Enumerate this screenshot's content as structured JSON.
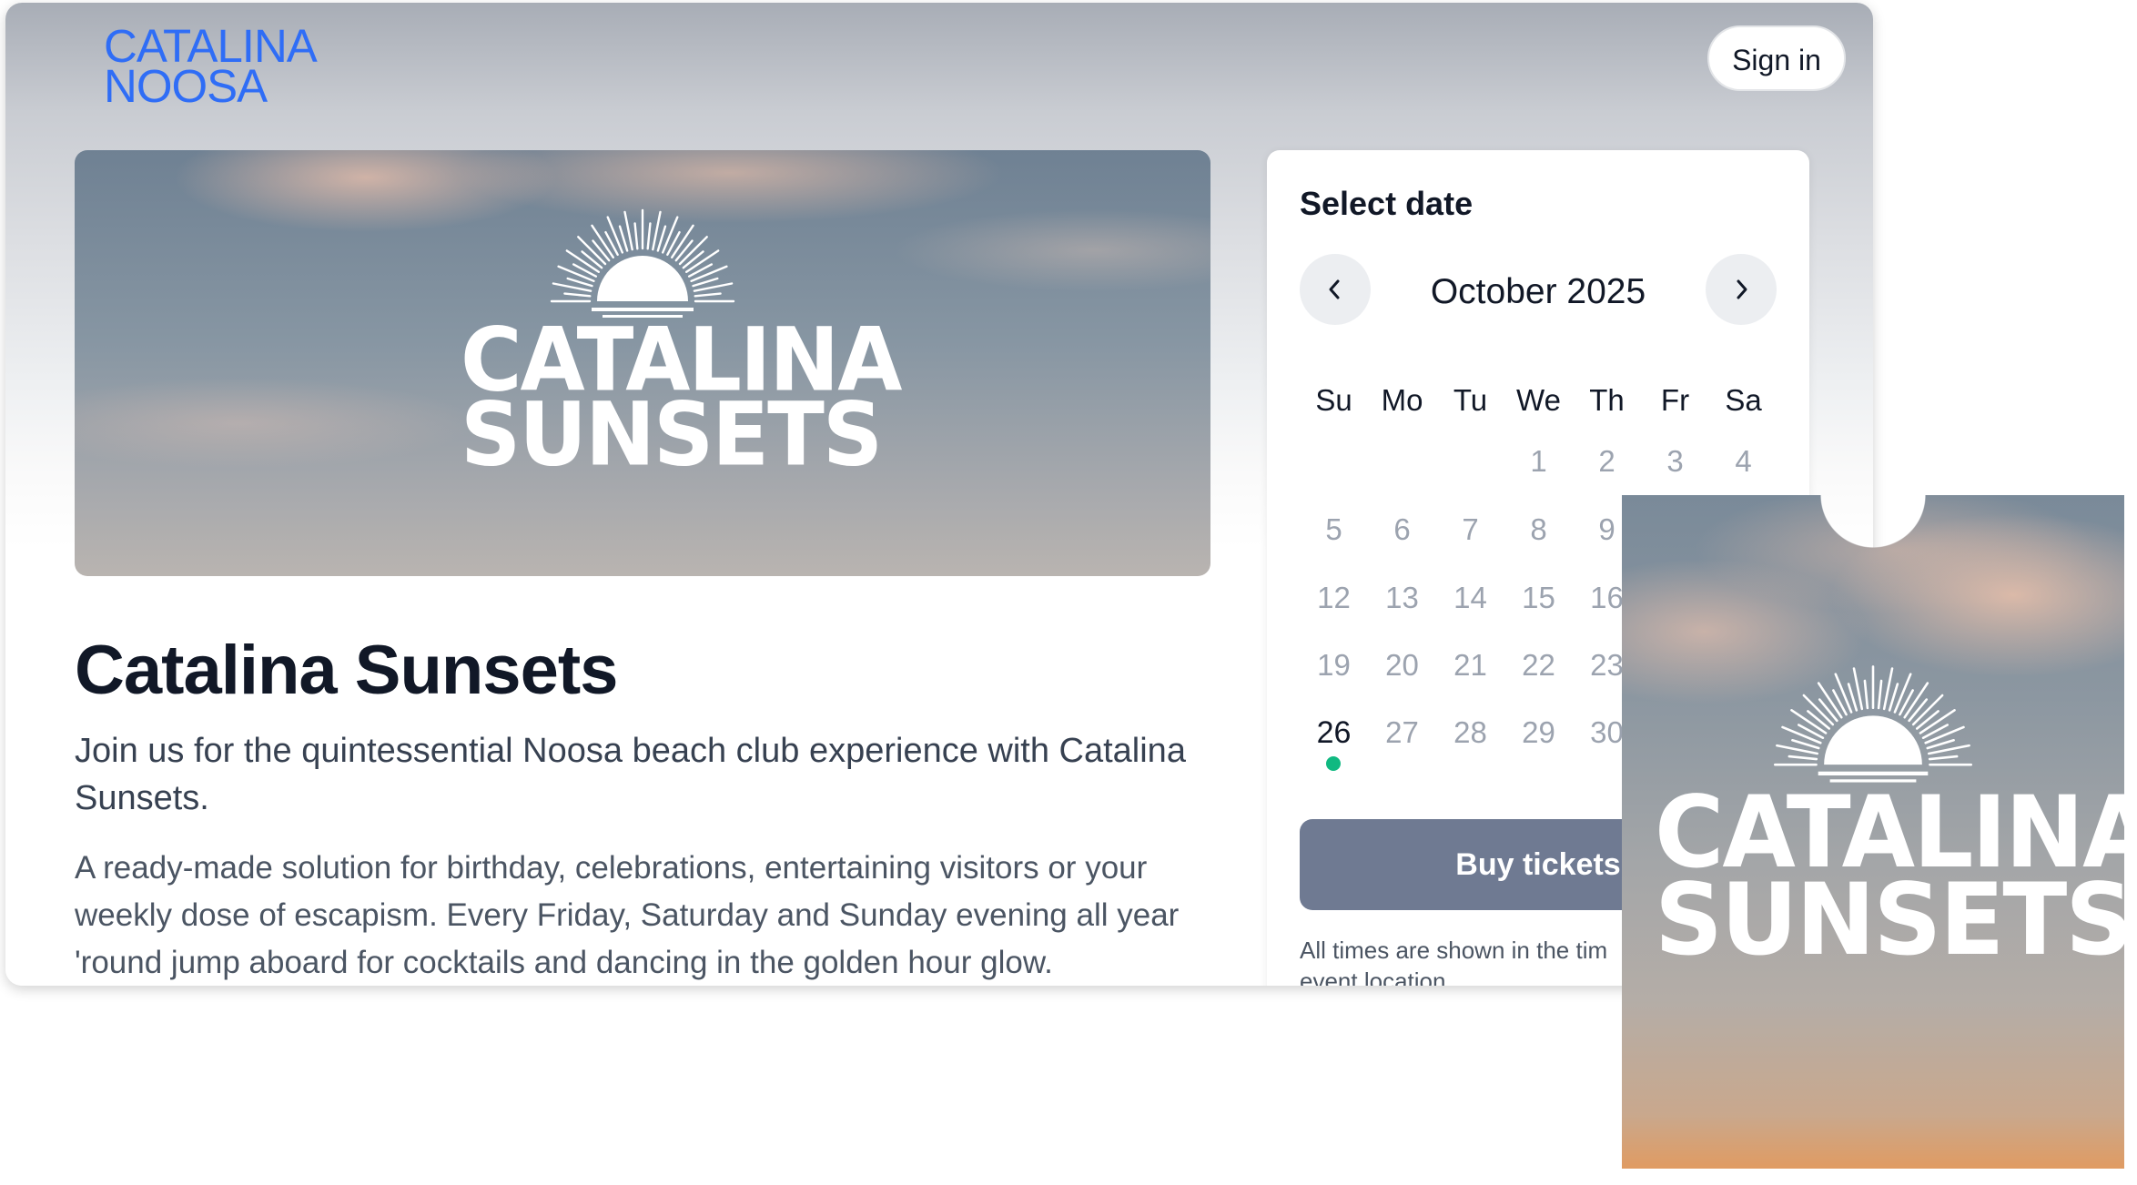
{
  "header": {
    "logo_line1": "CATALINA",
    "logo_line2": "NOOSA",
    "signin_label": "Sign in"
  },
  "hero": {
    "logo_word1": "CATALINA",
    "logo_word2": "SUNSETS"
  },
  "event": {
    "title": "Catalina Sunsets",
    "lead": "Join us for the quintessential Noosa beach club experience with Catalina Sunsets.",
    "description": "A ready-made solution for birthday, celebrations, entertaining visitors or your weekly dose of escapism. Every Friday, Saturday and Sunday evening all year 'round jump aboard for cocktails and dancing in the golden hour glow."
  },
  "calendar": {
    "heading": "Select date",
    "month_label": "October 2025",
    "prev_icon": "chevron-left-icon",
    "next_icon": "chevron-right-icon",
    "weekdays": [
      "Su",
      "Mo",
      "Tu",
      "We",
      "Th",
      "Fr",
      "Sa"
    ],
    "days": [
      [
        "1",
        "2",
        "3",
        "4"
      ],
      [
        "5",
        "6",
        "7",
        "8",
        "9"
      ],
      [
        "12",
        "13",
        "14",
        "15",
        "16"
      ],
      [
        "19",
        "20",
        "21",
        "22",
        "23"
      ],
      [
        "26",
        "27",
        "28",
        "29",
        "30"
      ]
    ],
    "available_day": "26",
    "buy_label": "Buy tickets",
    "timezone_note": "All times are shown in the tim event location."
  },
  "ticket": {
    "logo_word1": "CATALINA",
    "logo_word2": "SUNSETS"
  },
  "colors": {
    "brand_blue": "#2f6df6",
    "button": "#6f7a92",
    "available_dot": "#10b981",
    "text_dark": "#111827"
  }
}
